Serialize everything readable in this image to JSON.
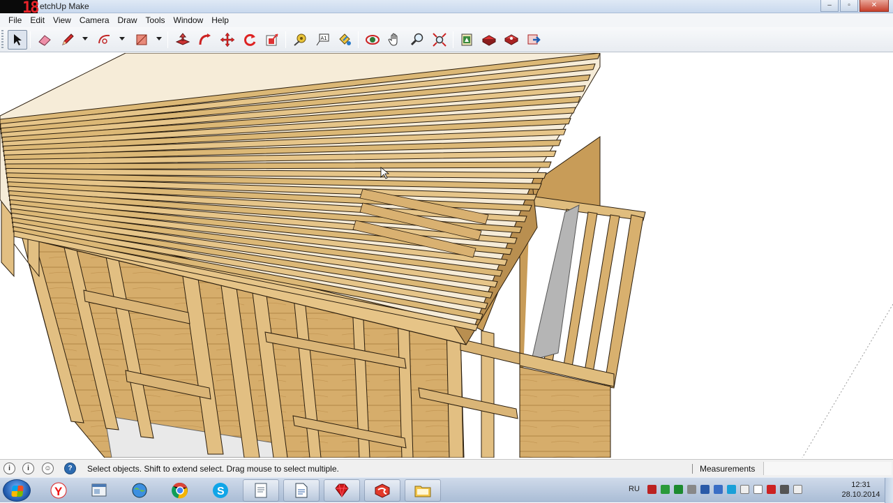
{
  "window": {
    "badge": "18",
    "title": "etchUp Make",
    "controls": [
      "–",
      "▫",
      "✕"
    ]
  },
  "menu": [
    "File",
    "Edit",
    "View",
    "Camera",
    "Draw",
    "Tools",
    "Window",
    "Help"
  ],
  "toolbar": {
    "tools": [
      {
        "name": "select",
        "icon": "arrow-cursor-icon",
        "active": true
      },
      {
        "name": "eraser",
        "icon": "eraser-icon"
      },
      {
        "name": "pencil",
        "icon": "pencil-icon"
      },
      {
        "name": "arc",
        "icon": "arc-icon"
      },
      {
        "name": "rectangle",
        "icon": "rectangle-icon"
      },
      {
        "name": "push-pull",
        "icon": "push-pull-icon"
      },
      {
        "name": "follow-me",
        "icon": "follow-me-icon"
      },
      {
        "name": "move",
        "icon": "move-icon"
      },
      {
        "name": "rotate",
        "icon": "rotate-icon"
      },
      {
        "name": "scale",
        "icon": "scale-icon"
      },
      {
        "name": "tape-measure",
        "icon": "tape-measure-icon"
      },
      {
        "name": "text",
        "icon": "text-icon",
        "glyph": "A1"
      },
      {
        "name": "paint-bucket",
        "icon": "paint-bucket-icon"
      },
      {
        "name": "orbit",
        "icon": "orbit-icon"
      },
      {
        "name": "pan",
        "icon": "pan-hand-icon"
      },
      {
        "name": "zoom",
        "icon": "zoom-icon"
      },
      {
        "name": "zoom-extents",
        "icon": "zoom-extents-icon"
      },
      {
        "name": "warehouse",
        "icon": "warehouse-icon"
      },
      {
        "name": "components",
        "icon": "components-icon"
      },
      {
        "name": "extensions",
        "icon": "extension-warehouse-icon"
      },
      {
        "name": "share-model",
        "icon": "share-model-icon"
      }
    ]
  },
  "status": {
    "message": "Select objects. Shift to extend select. Drag mouse to select multiple.",
    "measurements_label": "Measurements",
    "measurements_value": ""
  },
  "taskbar": {
    "apps": [
      "yandex-browser-icon",
      "window-icon",
      "network-globe-icon",
      "chrome-icon",
      "skype-icon",
      "notepad-icon",
      "document-icon",
      "ruby-icon",
      "sketchup-icon",
      "folder-icon"
    ],
    "language": "RU",
    "time": "12:31",
    "date": "28.10.2014"
  },
  "colors": {
    "wood_light": "#e4c489",
    "wood_mid": "#c99f5c",
    "wood_dark": "#8a6531",
    "outline": "#2a1d0d",
    "accent_red": "#e8232a"
  }
}
